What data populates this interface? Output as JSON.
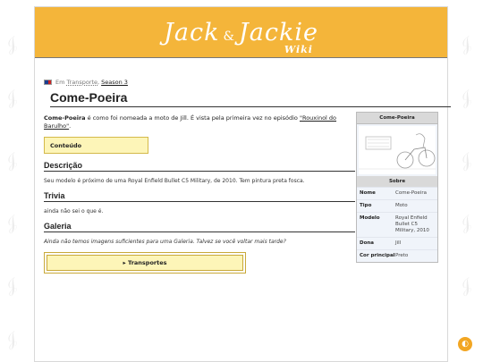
{
  "header": {
    "logo_main": "Jack",
    "logo_amp": "&",
    "logo_second": "Jackie",
    "logo_wiki": "Wiki"
  },
  "breadcrumb": {
    "prefix": "Em",
    "category": "Transporte",
    "separator": ",",
    "season": "Season 3"
  },
  "page_title": "Come-Poeira",
  "intro": {
    "bold": "Come-Poeira",
    "text": " é como foi nomeada a moto de Jill. É vista pela primeira vez no episódio ",
    "link": "\"Rouxinol do Barulho\"",
    "end": "."
  },
  "toc_label": "Conteúdo",
  "sections": {
    "descricao_title": "Descrição",
    "descricao_text": "Seu modelo é próximo de uma Royal Enfield Bullet C5 Military, de 2010. Tem pintura preta fosca.",
    "trivia_title": "Trivia",
    "trivia_text": "ainda não sei o que é.",
    "galeria_title": "Galeria",
    "galeria_text": "Ainda não temos imagens suficientes para uma Galeria. Talvez se você voltar mais tarde?"
  },
  "nav_box_label": "▸ Transportes",
  "infobox": {
    "title": "Come-Poeira",
    "subheader": "Sobre",
    "rows": [
      {
        "key": "Nome",
        "value": "Come-Poeira"
      },
      {
        "key": "Tipo",
        "value": "Moto"
      },
      {
        "key": "Modelo",
        "value": "Royal Enfield Bullet C5 Military, 2010"
      },
      {
        "key": "Dona",
        "value": "Jill"
      },
      {
        "key": "Cor principal",
        "value": "Preto"
      }
    ]
  },
  "theme": {
    "accent": "#f4b53a",
    "toc_bg": "#fdf5b8"
  },
  "icons": {
    "theme_toggle": "contrast-icon",
    "flag": "flag-icon"
  }
}
